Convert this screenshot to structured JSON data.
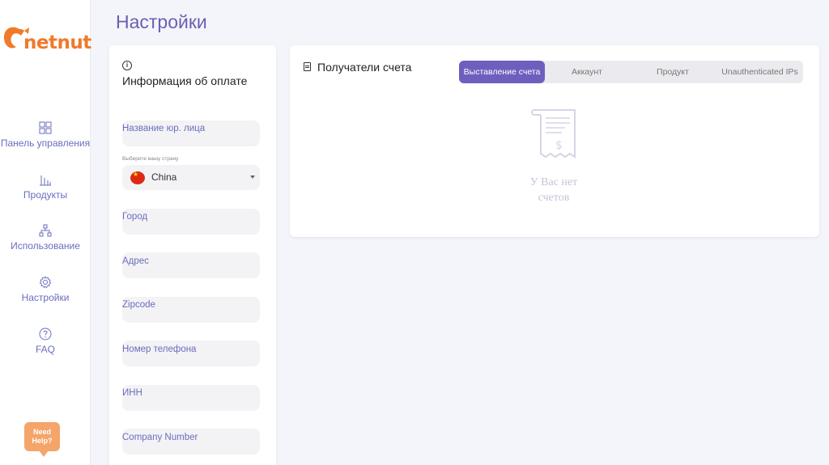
{
  "brand": {
    "logo_text": "netnut",
    "accent": "#6e5fbe",
    "logo_color": "#ef7a2a"
  },
  "sidebar": {
    "items": [
      {
        "label": "Панель управления",
        "icon": "dashboard-icon"
      },
      {
        "label": "Продукты",
        "icon": "bar-chart-icon"
      },
      {
        "label": "Использование",
        "icon": "hierarchy-icon"
      },
      {
        "label": "Настройки",
        "icon": "gear-icon"
      },
      {
        "label": "FAQ",
        "icon": "question-icon"
      }
    ],
    "need_help": "Need Help?"
  },
  "page": {
    "title": "Настройки"
  },
  "billing": {
    "title": "Информация об оплате",
    "fields": {
      "company_name": "Название юр. лица",
      "country_caption": "Выберите вашу страну",
      "country_value": "China",
      "city": "Город",
      "address": "Адрес",
      "zipcode": "Zipcode",
      "phone": "Номер телефона",
      "inn": "ИНН",
      "company_number": "Company Number"
    }
  },
  "invoices": {
    "title": "Получатели счета",
    "tabs": [
      {
        "label": "Выставление счета",
        "active": true
      },
      {
        "label": "Аккаунт",
        "active": false
      },
      {
        "label": "Продукт",
        "active": false
      },
      {
        "label": "Unauthenticated IPs",
        "active": false
      }
    ],
    "empty_line1": "У Вас нет",
    "empty_line2": "счетов"
  }
}
